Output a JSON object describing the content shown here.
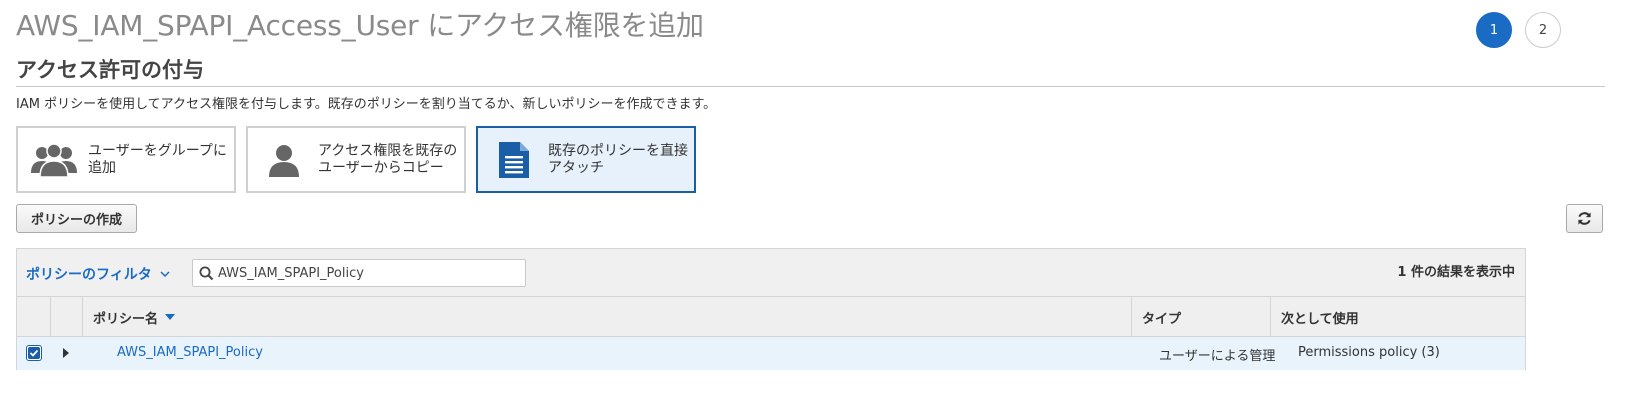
{
  "page": {
    "title": "AWS_IAM_SPAPI_Access_User にアクセス権限を追加",
    "steps": [
      "1",
      "2"
    ],
    "active_step": "1"
  },
  "section": {
    "title": "アクセス許可の付与",
    "description": "IAM ポリシーを使用してアクセス権限を付与します。既存のポリシーを割り当てるか、新しいポリシーを作成できます。"
  },
  "options": [
    {
      "label": "ユーザーをグループに追加",
      "icon": "group-icon",
      "selected": false
    },
    {
      "label": "アクセス権限を既存のユーザーからコピー",
      "icon": "user-icon",
      "selected": false
    },
    {
      "label": "既存のポリシーを直接アタッチ",
      "icon": "document-icon",
      "selected": true
    }
  ],
  "toolbar": {
    "create_policy_label": "ポリシーの作成",
    "refresh_icon": "refresh-icon"
  },
  "filter": {
    "label": "ポリシーのフィルタ",
    "search_value": "AWS_IAM_SPAPI_Policy",
    "result_count": "1 件の結果を表示中"
  },
  "table": {
    "columns": [
      "ポリシー名",
      "タイプ",
      "次として使用"
    ],
    "rows": [
      {
        "checked": true,
        "name": "AWS_IAM_SPAPI_Policy",
        "type": "ユーザーによる管理",
        "used_as": "Permissions policy (3)"
      }
    ]
  },
  "colors": {
    "accent": "#1a6bc4",
    "selected_card_bg": "#e6f1fb",
    "row_highlight": "#e9f3fb",
    "icon_gray": "#666666"
  }
}
